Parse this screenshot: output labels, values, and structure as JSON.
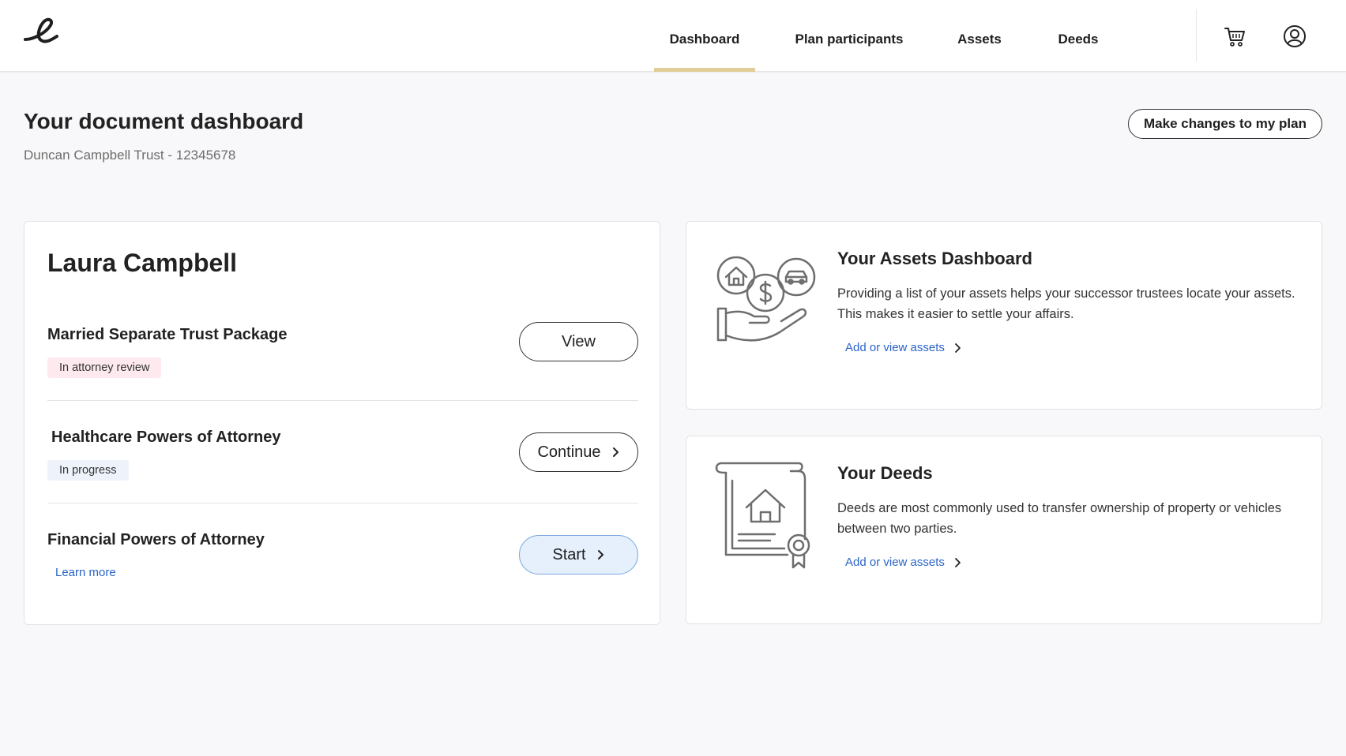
{
  "nav": {
    "items": [
      {
        "label": "Dashboard",
        "active": true
      },
      {
        "label": "Plan participants",
        "active": false
      },
      {
        "label": "Assets",
        "active": false
      },
      {
        "label": "Deeds",
        "active": false
      }
    ],
    "icons": [
      "cart-icon",
      "account-icon"
    ],
    "accent": "#e2cc98"
  },
  "header": {
    "title": "Your document dashboard",
    "subtitle": "Duncan Campbell Trust - 12345678",
    "action_label": "Make changes to my plan"
  },
  "person": {
    "name": "Laura Campbell",
    "documents": [
      {
        "title": "Married Separate Trust Package",
        "status": "In attorney review",
        "button": "View"
      },
      {
        "title": "Healthcare Powers of Attorney",
        "status": "In progress",
        "button": "Continue"
      },
      {
        "title": "Financial Powers of Attorney",
        "link": "Learn more",
        "button": "Start"
      }
    ]
  },
  "assets_card": {
    "title": "Your Assets Dashboard",
    "text": "Providing a list of your assets helps your successor trustees locate your assets. This makes it easier to settle your affairs.",
    "link": "Add or view assets",
    "icon": "assets-hand-icon"
  },
  "deeds_card": {
    "title": "Your Deeds",
    "text": "Deeds are most commonly used to transfer ownership of property or vehicles between two parties.",
    "link": "Add or view assets",
    "icon": "deed-document-icon"
  },
  "colors": {
    "link": "#2a64c9",
    "badge_review": "#fde9ee",
    "badge_progress": "#eef3fb",
    "start_button": "#e5f0fc"
  }
}
